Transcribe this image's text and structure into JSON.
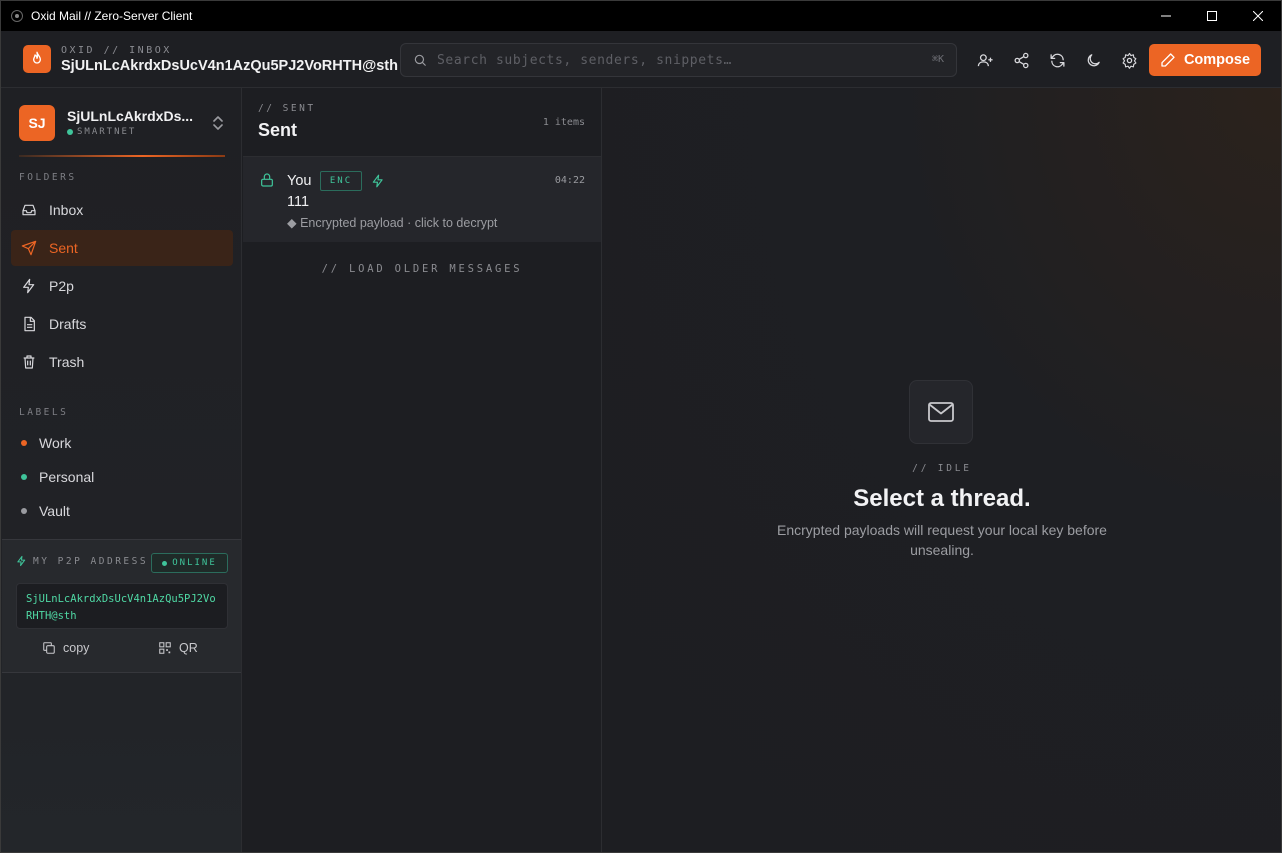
{
  "window": {
    "title": "Oxid Mail // Zero-Server Client"
  },
  "header": {
    "brand_sub": "OXID // INBOX",
    "brand_main": "SjULnLcAkrdxDsUcV4n1AzQu5PJ2VoRHTH@sth",
    "search_placeholder": "Search subjects, senders, snippets…",
    "search_shortcut": "⌘K",
    "compose_label": "Compose"
  },
  "sidebar": {
    "account": {
      "initials": "SJ",
      "name": "SjULnLcAkrdxDs...",
      "network": "SMARTNET"
    },
    "folders_label": "FOLDERS",
    "folders": [
      {
        "label": "Inbox",
        "icon": "inbox-icon"
      },
      {
        "label": "Sent",
        "icon": "send-icon",
        "active": true
      },
      {
        "label": "P2p",
        "icon": "bolt-icon"
      },
      {
        "label": "Drafts",
        "icon": "file-icon"
      },
      {
        "label": "Trash",
        "icon": "trash-icon"
      }
    ],
    "labels_label": "LABELS",
    "labels": [
      {
        "label": "Work",
        "color": "#ec6524"
      },
      {
        "label": "Personal",
        "color": "#3fc49a"
      },
      {
        "label": "Vault",
        "color": "#9a9ba0"
      }
    ],
    "p2p": {
      "title": "MY P2P ADDRESS",
      "status": "ONLINE",
      "address": "SjULnLcAkrdxDsUcV4n1AzQu5PJ2VoRHTH@sth",
      "copy_label": "copy",
      "qr_label": "QR"
    }
  },
  "list": {
    "sub": "// SENT",
    "title": "Sent",
    "count": "1 items",
    "messages": [
      {
        "sender": "You",
        "badge": "ENC",
        "time": "04:22",
        "subject": "111",
        "snippet": "◆ Encrypted payload · click to decrypt"
      }
    ],
    "load_older": "// LOAD OLDER MESSAGES"
  },
  "detail": {
    "tag": "// IDLE",
    "title": "Select a thread.",
    "description": "Encrypted payloads will request your local key before unsealing."
  },
  "colors": {
    "accent": "#ec6524",
    "success": "#3fc49a",
    "address": "#4fd8a4"
  }
}
